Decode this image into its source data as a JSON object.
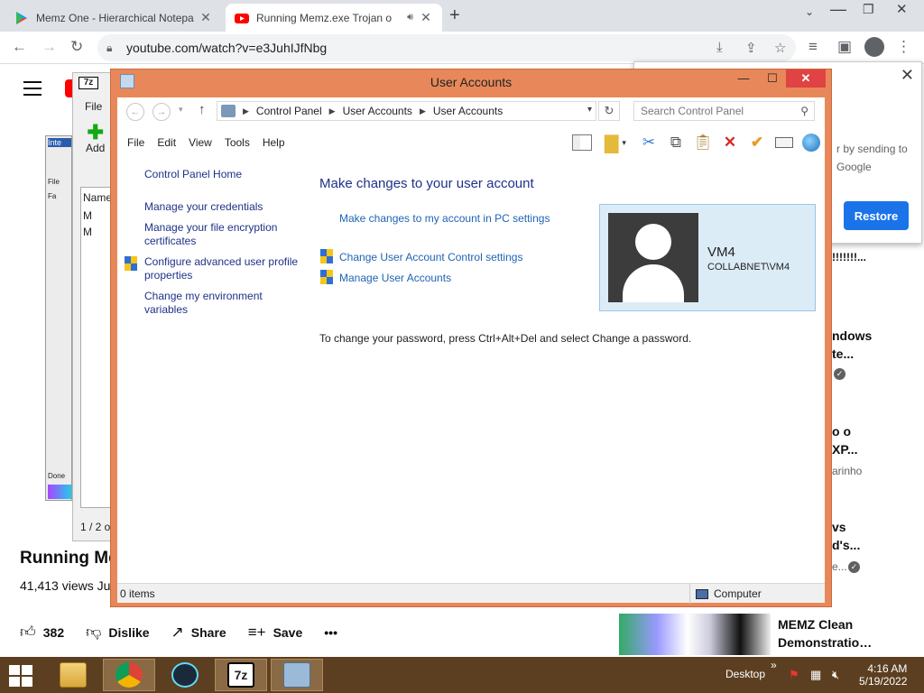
{
  "browser": {
    "tabs": [
      {
        "title": "Memz One - Hierarchical Notepa"
      },
      {
        "title": "Running Memz.exe Trojan o"
      }
    ],
    "url": "youtube.com/watch?v=e3JuhIJfNbg"
  },
  "youtube": {
    "video_title": "Running Mem",
    "views": "41,413 views  Ju",
    "likes": "382",
    "dislike": "Dislike",
    "share": "Share",
    "save": "Save",
    "more": "•••",
    "recommendations": {
      "title": "MEMZ Clean Demonstratio…",
      "side": [
        {
          "text": "!!!!!!!..."
        },
        {
          "text": "ndows"
        },
        {
          "text": "te..."
        },
        {
          "text": "o o"
        },
        {
          "text": "XP..."
        },
        {
          "text": "arinho"
        },
        {
          "text": "vs"
        },
        {
          "text": "d's..."
        },
        {
          "text": "e..."
        }
      ]
    },
    "restore_popup": {
      "text": "r by sending to Google",
      "restore_label": "Restore"
    }
  },
  "sevenzip": {
    "logo": "7z",
    "menu_file": "File",
    "add_label": "Add",
    "col_name": "Name",
    "row1": "M",
    "row2": "M",
    "status": "1 / 2 o"
  },
  "ie_window": {
    "tab": "Inte",
    "file": "File",
    "fav": "Fa",
    "done": "Done"
  },
  "control_panel": {
    "window_title": "User Accounts",
    "breadcrumb": [
      "Control Panel",
      "User Accounts",
      "User Accounts"
    ],
    "search_placeholder": "Search Control Panel",
    "menu": [
      "File",
      "Edit",
      "View",
      "Tools",
      "Help"
    ],
    "left_pane": {
      "home": "Control Panel Home",
      "credentials": "Manage your credentials",
      "encryption": "Manage your file encryption certificates",
      "profile": "Configure advanced user profile properties",
      "environment": "Change my environment variables"
    },
    "heading": "Make changes to your user account",
    "link_pc_settings": "Make changes to my account in PC settings",
    "link_uac": "Change User Account Control settings",
    "link_manage": "Manage User Accounts",
    "note": "To change your password, press Ctrl+Alt+Del and select Change a password.",
    "account": {
      "name": "VM4",
      "domain": "COLLABNET\\VM4"
    },
    "status_items": "0 items",
    "status_computer": "Computer"
  },
  "taskbar": {
    "desktop_label": "Desktop",
    "chevron": "»",
    "time": "4:16 AM",
    "date": "5/19/2022"
  },
  "colors": {
    "window_frame": "#e8885a",
    "taskbar": "#5b3f20",
    "link": "#1e64b4",
    "heading": "#1e3287",
    "account_bg": "#dcecf7",
    "restore_button": "#1a73e8"
  }
}
